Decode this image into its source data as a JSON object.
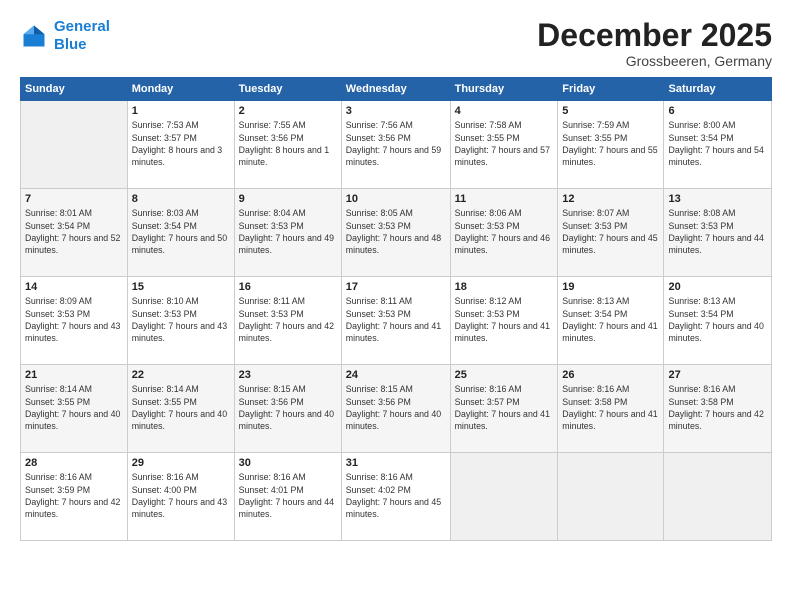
{
  "logo": {
    "line1": "General",
    "line2": "Blue"
  },
  "title": "December 2025",
  "location": "Grossbeeren, Germany",
  "days_header": [
    "Sunday",
    "Monday",
    "Tuesday",
    "Wednesday",
    "Thursday",
    "Friday",
    "Saturday"
  ],
  "weeks": [
    [
      {
        "day": "",
        "sunrise": "",
        "sunset": "",
        "daylight": ""
      },
      {
        "day": "1",
        "sunrise": "Sunrise: 7:53 AM",
        "sunset": "Sunset: 3:57 PM",
        "daylight": "Daylight: 8 hours and 3 minutes."
      },
      {
        "day": "2",
        "sunrise": "Sunrise: 7:55 AM",
        "sunset": "Sunset: 3:56 PM",
        "daylight": "Daylight: 8 hours and 1 minute."
      },
      {
        "day": "3",
        "sunrise": "Sunrise: 7:56 AM",
        "sunset": "Sunset: 3:56 PM",
        "daylight": "Daylight: 7 hours and 59 minutes."
      },
      {
        "day": "4",
        "sunrise": "Sunrise: 7:58 AM",
        "sunset": "Sunset: 3:55 PM",
        "daylight": "Daylight: 7 hours and 57 minutes."
      },
      {
        "day": "5",
        "sunrise": "Sunrise: 7:59 AM",
        "sunset": "Sunset: 3:55 PM",
        "daylight": "Daylight: 7 hours and 55 minutes."
      },
      {
        "day": "6",
        "sunrise": "Sunrise: 8:00 AM",
        "sunset": "Sunset: 3:54 PM",
        "daylight": "Daylight: 7 hours and 54 minutes."
      }
    ],
    [
      {
        "day": "7",
        "sunrise": "Sunrise: 8:01 AM",
        "sunset": "Sunset: 3:54 PM",
        "daylight": "Daylight: 7 hours and 52 minutes."
      },
      {
        "day": "8",
        "sunrise": "Sunrise: 8:03 AM",
        "sunset": "Sunset: 3:54 PM",
        "daylight": "Daylight: 7 hours and 50 minutes."
      },
      {
        "day": "9",
        "sunrise": "Sunrise: 8:04 AM",
        "sunset": "Sunset: 3:53 PM",
        "daylight": "Daylight: 7 hours and 49 minutes."
      },
      {
        "day": "10",
        "sunrise": "Sunrise: 8:05 AM",
        "sunset": "Sunset: 3:53 PM",
        "daylight": "Daylight: 7 hours and 48 minutes."
      },
      {
        "day": "11",
        "sunrise": "Sunrise: 8:06 AM",
        "sunset": "Sunset: 3:53 PM",
        "daylight": "Daylight: 7 hours and 46 minutes."
      },
      {
        "day": "12",
        "sunrise": "Sunrise: 8:07 AM",
        "sunset": "Sunset: 3:53 PM",
        "daylight": "Daylight: 7 hours and 45 minutes."
      },
      {
        "day": "13",
        "sunrise": "Sunrise: 8:08 AM",
        "sunset": "Sunset: 3:53 PM",
        "daylight": "Daylight: 7 hours and 44 minutes."
      }
    ],
    [
      {
        "day": "14",
        "sunrise": "Sunrise: 8:09 AM",
        "sunset": "Sunset: 3:53 PM",
        "daylight": "Daylight: 7 hours and 43 minutes."
      },
      {
        "day": "15",
        "sunrise": "Sunrise: 8:10 AM",
        "sunset": "Sunset: 3:53 PM",
        "daylight": "Daylight: 7 hours and 43 minutes."
      },
      {
        "day": "16",
        "sunrise": "Sunrise: 8:11 AM",
        "sunset": "Sunset: 3:53 PM",
        "daylight": "Daylight: 7 hours and 42 minutes."
      },
      {
        "day": "17",
        "sunrise": "Sunrise: 8:11 AM",
        "sunset": "Sunset: 3:53 PM",
        "daylight": "Daylight: 7 hours and 41 minutes."
      },
      {
        "day": "18",
        "sunrise": "Sunrise: 8:12 AM",
        "sunset": "Sunset: 3:53 PM",
        "daylight": "Daylight: 7 hours and 41 minutes."
      },
      {
        "day": "19",
        "sunrise": "Sunrise: 8:13 AM",
        "sunset": "Sunset: 3:54 PM",
        "daylight": "Daylight: 7 hours and 41 minutes."
      },
      {
        "day": "20",
        "sunrise": "Sunrise: 8:13 AM",
        "sunset": "Sunset: 3:54 PM",
        "daylight": "Daylight: 7 hours and 40 minutes."
      }
    ],
    [
      {
        "day": "21",
        "sunrise": "Sunrise: 8:14 AM",
        "sunset": "Sunset: 3:55 PM",
        "daylight": "Daylight: 7 hours and 40 minutes."
      },
      {
        "day": "22",
        "sunrise": "Sunrise: 8:14 AM",
        "sunset": "Sunset: 3:55 PM",
        "daylight": "Daylight: 7 hours and 40 minutes."
      },
      {
        "day": "23",
        "sunrise": "Sunrise: 8:15 AM",
        "sunset": "Sunset: 3:56 PM",
        "daylight": "Daylight: 7 hours and 40 minutes."
      },
      {
        "day": "24",
        "sunrise": "Sunrise: 8:15 AM",
        "sunset": "Sunset: 3:56 PM",
        "daylight": "Daylight: 7 hours and 40 minutes."
      },
      {
        "day": "25",
        "sunrise": "Sunrise: 8:16 AM",
        "sunset": "Sunset: 3:57 PM",
        "daylight": "Daylight: 7 hours and 41 minutes."
      },
      {
        "day": "26",
        "sunrise": "Sunrise: 8:16 AM",
        "sunset": "Sunset: 3:58 PM",
        "daylight": "Daylight: 7 hours and 41 minutes."
      },
      {
        "day": "27",
        "sunrise": "Sunrise: 8:16 AM",
        "sunset": "Sunset: 3:58 PM",
        "daylight": "Daylight: 7 hours and 42 minutes."
      }
    ],
    [
      {
        "day": "28",
        "sunrise": "Sunrise: 8:16 AM",
        "sunset": "Sunset: 3:59 PM",
        "daylight": "Daylight: 7 hours and 42 minutes."
      },
      {
        "day": "29",
        "sunrise": "Sunrise: 8:16 AM",
        "sunset": "Sunset: 4:00 PM",
        "daylight": "Daylight: 7 hours and 43 minutes."
      },
      {
        "day": "30",
        "sunrise": "Sunrise: 8:16 AM",
        "sunset": "Sunset: 4:01 PM",
        "daylight": "Daylight: 7 hours and 44 minutes."
      },
      {
        "day": "31",
        "sunrise": "Sunrise: 8:16 AM",
        "sunset": "Sunset: 4:02 PM",
        "daylight": "Daylight: 7 hours and 45 minutes."
      },
      {
        "day": "",
        "sunrise": "",
        "sunset": "",
        "daylight": ""
      },
      {
        "day": "",
        "sunrise": "",
        "sunset": "",
        "daylight": ""
      },
      {
        "day": "",
        "sunrise": "",
        "sunset": "",
        "daylight": ""
      }
    ]
  ]
}
